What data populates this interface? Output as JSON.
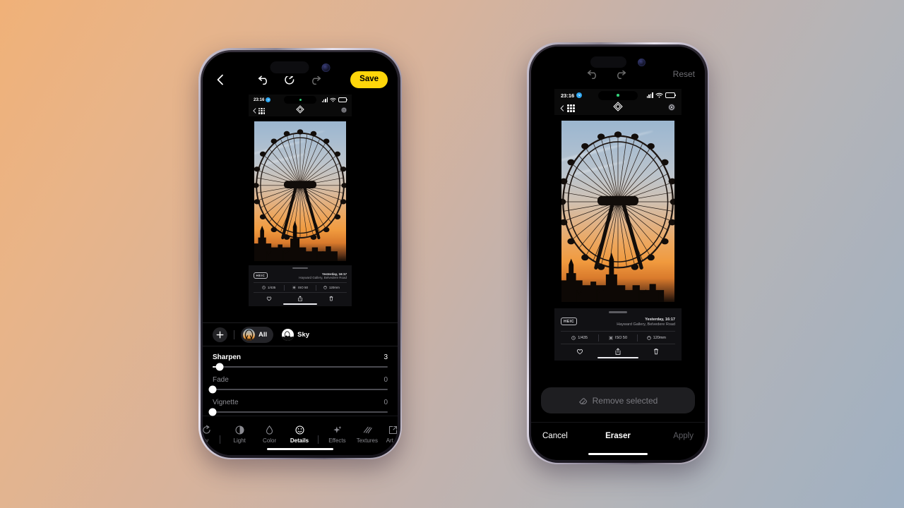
{
  "background": {
    "start_color": "#f0b178",
    "end_color": "#9fb0c2"
  },
  "left_phone": {
    "topbar": {
      "back_icon": "chevron-left-icon",
      "undo_icon": "undo-arrow-icon",
      "revert_icon": "revert-circular-arrow-icon",
      "redo_icon": "redo-arrow-icon",
      "save_label": "Save",
      "save_color": "#FFD60A"
    },
    "screenshot": {
      "status": {
        "time": "23:16",
        "app_badge": "telegram-icon",
        "signal": "cellular-bars-icon",
        "wifi": "wifi-icon",
        "battery": "battery-icon"
      },
      "nav": {
        "back_icon": "chevron-left-icon",
        "grid_icon": "grid-icon",
        "logo_icon": "photos-logo-icon",
        "target_icon": "target-icon"
      },
      "photo_alt": "London Eye ferris wheel silhouetted against an orange sunset sky with Big Ben",
      "meta": {
        "format": "HEIC",
        "date": "Yesterday, 16:17",
        "location": "Hayward Gallery, Belvedere Road",
        "shutter": "1/435",
        "iso": "ISO 50",
        "focal": "120mm",
        "shutter_icon": "shutter-icon",
        "iso_icon": "iso-icon",
        "focal_icon": "aperture-icon",
        "favorite_icon": "heart-icon",
        "share_icon": "share-icon",
        "delete_icon": "trash-icon"
      }
    },
    "masks": {
      "add_icon": "plus-icon",
      "items": [
        {
          "label": "All",
          "selected": true,
          "thumb": "photo-thumb"
        },
        {
          "label": "Sky",
          "selected": false,
          "thumb": "sky-mask-thumb"
        }
      ]
    },
    "sliders": [
      {
        "name": "Sharpen",
        "value": "3",
        "active": true,
        "pct": 4
      },
      {
        "name": "Fade",
        "value": "0",
        "active": false,
        "pct": 0
      },
      {
        "name": "Vignette",
        "value": "0",
        "active": false,
        "pct": 0
      }
    ],
    "tabs": [
      {
        "label": "ty",
        "icon": "quality-icon",
        "active": false,
        "clipped": true
      },
      {
        "label": "Light",
        "icon": "brightness-icon",
        "active": false
      },
      {
        "label": "Color",
        "icon": "droplet-icon",
        "active": false
      },
      {
        "label": "Details",
        "icon": "details-icon",
        "active": true
      },
      {
        "label": "Effects",
        "icon": "sparkle-icon",
        "active": false
      },
      {
        "label": "Textures",
        "icon": "texture-lines-icon",
        "active": false
      },
      {
        "label": "Art st",
        "icon": "art-style-icon",
        "active": false,
        "clipped": true
      }
    ]
  },
  "right_phone": {
    "topbar": {
      "undo_icon": "undo-arrow-icon",
      "redo_icon": "redo-arrow-icon",
      "reset_label": "Reset"
    },
    "screenshot": {
      "status": {
        "time": "23:16",
        "app_badge": "telegram-icon",
        "signal": "cellular-bars-icon",
        "wifi": "wifi-icon",
        "battery": "battery-icon"
      },
      "nav": {
        "back_icon": "chevron-left-icon",
        "grid_icon": "grid-icon",
        "logo_icon": "photos-logo-icon",
        "target_icon": "target-icon"
      },
      "photo_alt": "London Eye ferris wheel silhouetted against an orange sunset sky with Big Ben",
      "meta": {
        "format": "HEIC",
        "date": "Yesterday, 16:17",
        "location": "Hayward Gallery, Belvedere Road",
        "shutter": "1/435",
        "iso": "ISO 50",
        "focal": "120mm",
        "shutter_icon": "shutter-icon",
        "iso_icon": "iso-icon",
        "focal_icon": "aperture-icon",
        "favorite_icon": "heart-icon",
        "share_icon": "share-icon",
        "delete_icon": "trash-icon"
      }
    },
    "eraser": {
      "remove_label": "Remove selected",
      "remove_icon": "eraser-icon",
      "cancel_label": "Cancel",
      "title": "Eraser",
      "apply_label": "Apply"
    }
  }
}
